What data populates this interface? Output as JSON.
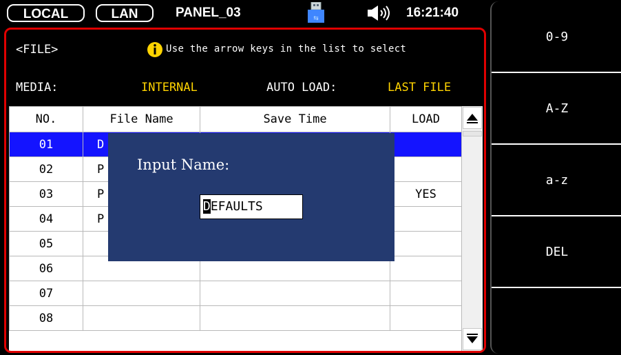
{
  "status_bar": {
    "local_label": "LOCAL",
    "lan_label": "LAN",
    "panel_name": "PANEL_03",
    "time": "16:21:40",
    "icons": [
      "usb-icon",
      "speaker-icon"
    ]
  },
  "file_panel": {
    "title": "<FILE>",
    "hint": "Use the arrow keys in the list to select",
    "media_label": "MEDIA:",
    "media_value": "INTERNAL",
    "autoload_label": "AUTO LOAD:",
    "autoload_value": "LAST FILE"
  },
  "table": {
    "headers": [
      "NO.",
      "File Name",
      "Save Time",
      "LOAD"
    ],
    "rows": [
      {
        "no": "01",
        "name": "D",
        "save_time": "",
        "load": ""
      },
      {
        "no": "02",
        "name": "P",
        "save_time": "",
        "load": ""
      },
      {
        "no": "03",
        "name": "P",
        "save_time": "",
        "load": "YES"
      },
      {
        "no": "04",
        "name": "P",
        "save_time": "",
        "load": ""
      },
      {
        "no": "05",
        "name": "",
        "save_time": "",
        "load": ""
      },
      {
        "no": "06",
        "name": "",
        "save_time": "",
        "load": ""
      },
      {
        "no": "07",
        "name": "",
        "save_time": "",
        "load": ""
      },
      {
        "no": "08",
        "name": "",
        "save_time": "",
        "load": ""
      }
    ],
    "selected_row": "01"
  },
  "dialog": {
    "label": "Input Name:",
    "input_cursor_char": "D",
    "input_rest": "EFAULTS"
  },
  "softkeys": [
    "0-9",
    "A-Z",
    "a-z",
    "DEL",
    ""
  ],
  "colors": {
    "selected_row": "#1414ff",
    "dialog_bg": "#243a70",
    "value_yellow": "#ffd400",
    "panel_border": "#e00000"
  }
}
